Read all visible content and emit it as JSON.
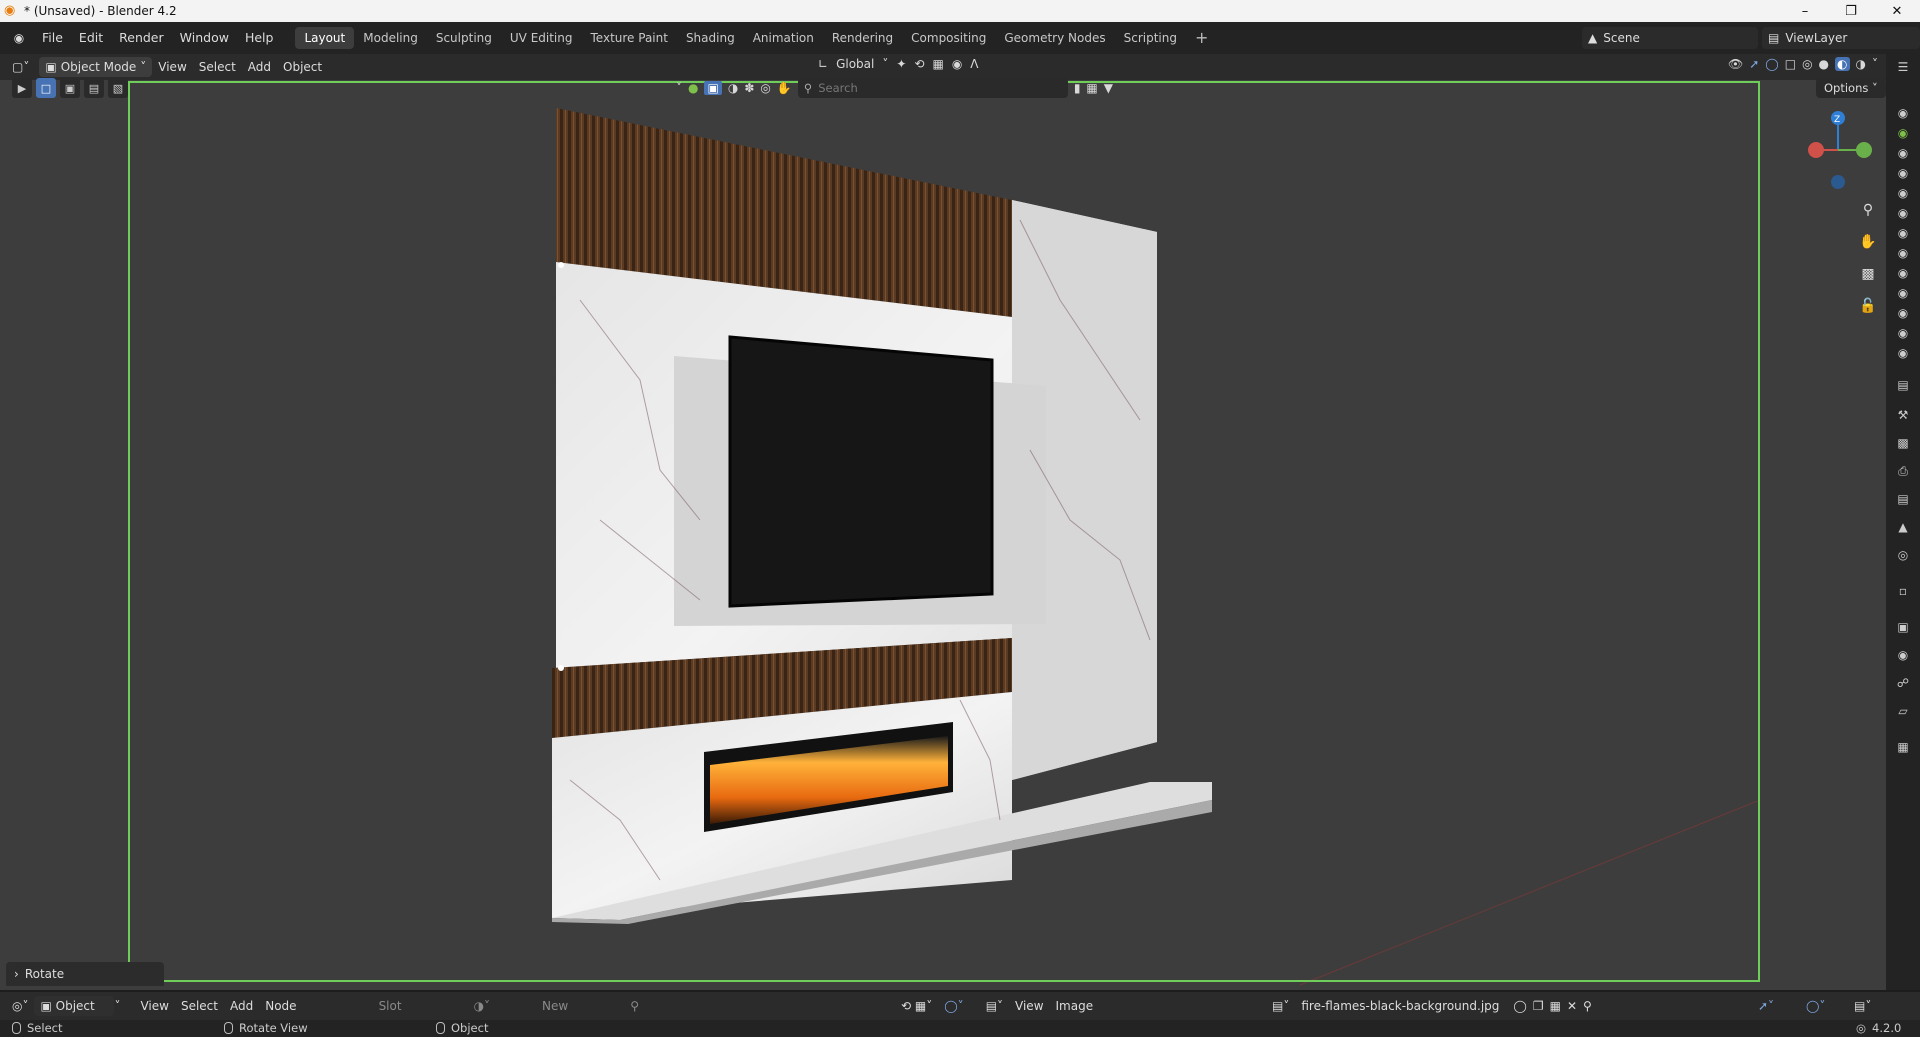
{
  "window": {
    "title": "* (Unsaved) - Blender 4.2"
  },
  "menu": [
    "File",
    "Edit",
    "Render",
    "Window",
    "Help"
  ],
  "workspaces": [
    "Layout",
    "Modeling",
    "Sculpting",
    "UV Editing",
    "Texture Paint",
    "Shading",
    "Animation",
    "Rendering",
    "Compositing",
    "Geometry Nodes",
    "Scripting"
  ],
  "active_workspace": "Layout",
  "scene": {
    "name": "Scene"
  },
  "view_layer": {
    "name": "ViewLayer"
  },
  "viewport_header": {
    "mode": "Object Mode",
    "menus": [
      "View",
      "Select",
      "Add",
      "Object"
    ],
    "orientation": "Global"
  },
  "viewport": {
    "search_placeholder": "Search",
    "options_label": "Options",
    "last_operator": "Rotate",
    "gizmo_axis": "Z"
  },
  "image_editor": {
    "object_label": "Object",
    "menus": [
      "View",
      "Select",
      "Add",
      "Node"
    ],
    "slot_label": "Slot",
    "new_label": "New",
    "right_menus": [
      "View",
      "Image"
    ],
    "image_name": "fire-flames-black-background.jpg"
  },
  "status": {
    "select": "Select",
    "rotate_view": "Rotate View",
    "object": "Object",
    "version": "4.2.0"
  },
  "colors": {
    "accent": "#4772b3",
    "active_outline": "#6fce5a",
    "fire": "#e86a10",
    "wood": "#5a3a22"
  }
}
